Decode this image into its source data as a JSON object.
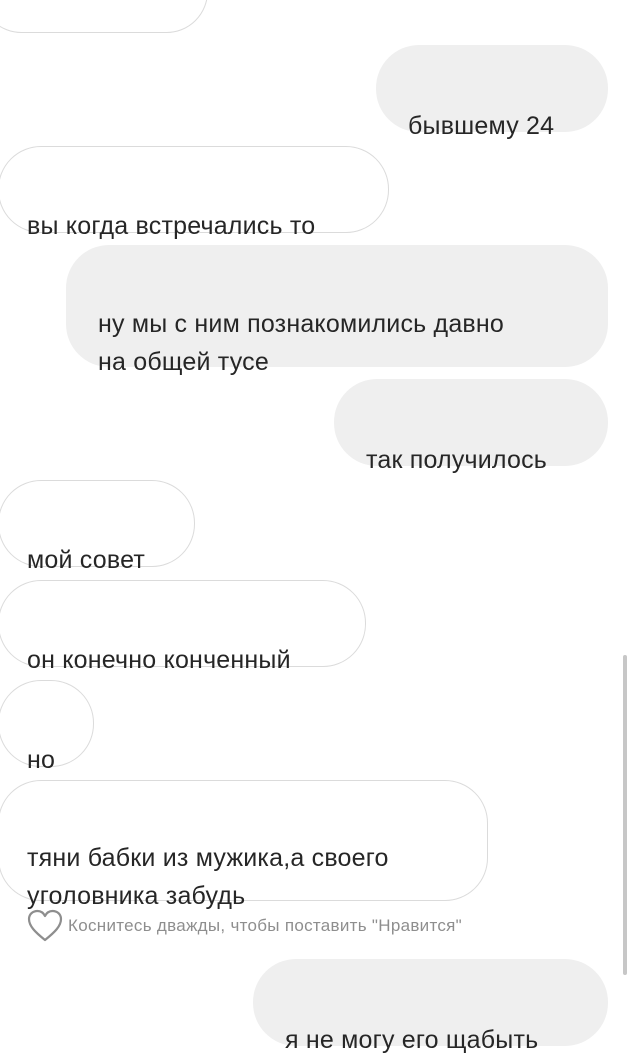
{
  "messages": [
    {
      "side": "in",
      "text": ""
    },
    {
      "side": "out",
      "text": "бывшему 24"
    },
    {
      "side": "in",
      "text": "вы когда встречались то"
    },
    {
      "side": "out",
      "text": "ну мы с ним познакомились давно\nна общей тусе"
    },
    {
      "side": "out",
      "text": "так получилось"
    },
    {
      "side": "in",
      "text": "мой совет"
    },
    {
      "side": "in",
      "text": "он конечно конченный"
    },
    {
      "side": "in",
      "text": "но"
    },
    {
      "side": "in",
      "text": "тяни бабки из мужика,а своего\nуголовника забудь"
    },
    {
      "side": "out",
      "text": "я не могу его щабыть"
    }
  ],
  "like_hint": {
    "icon": "heart-icon",
    "text": "Коснитесь дважды, чтобы поставить \"Нравится\""
  },
  "colors": {
    "outgoing_bubble": "#efefef",
    "incoming_border": "#dbdbdb",
    "text": "#262626",
    "hint": "#8e8e8e"
  }
}
